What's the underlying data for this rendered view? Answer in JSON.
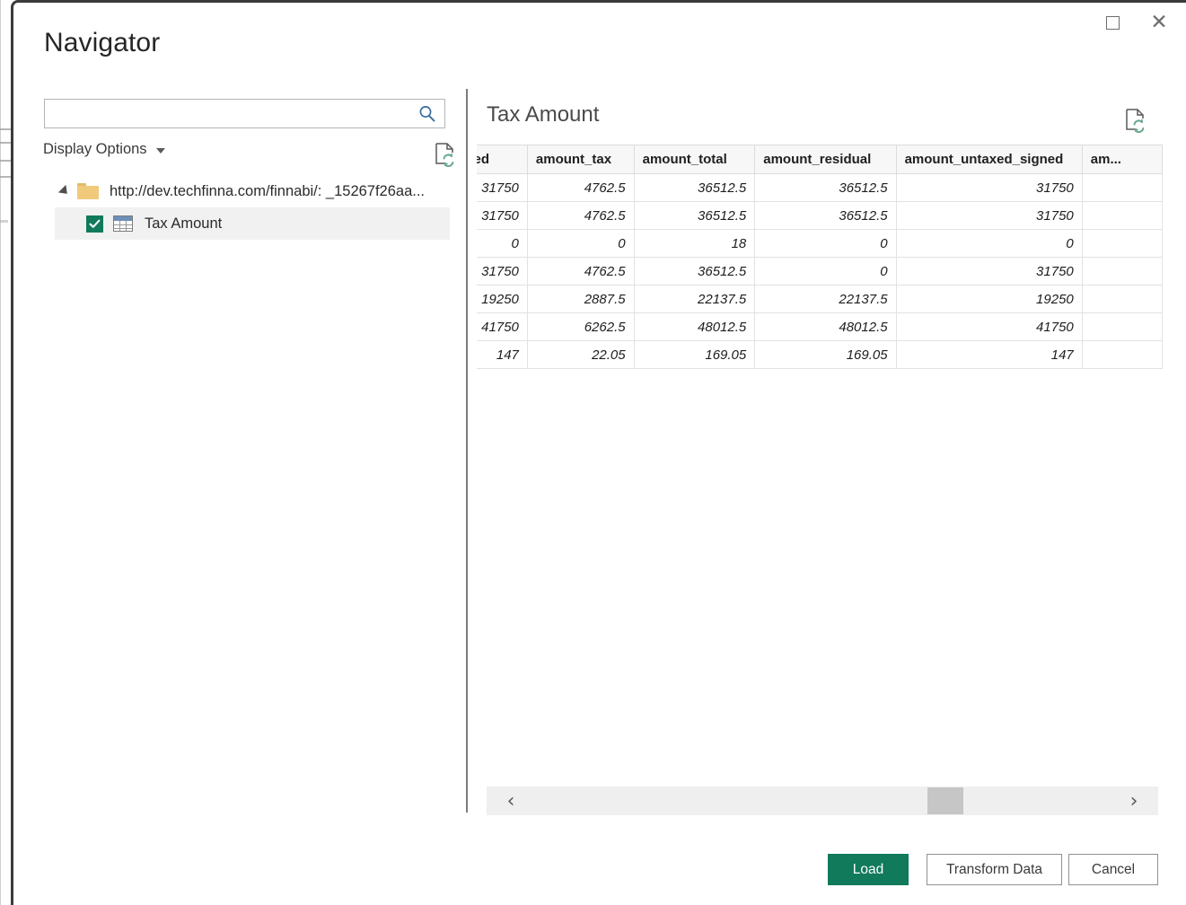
{
  "window": {
    "title": "Navigator",
    "maximize_label": "Maximize",
    "close_label": "Close"
  },
  "search": {
    "value": "",
    "placeholder": "",
    "icon": "search-icon"
  },
  "left_pane": {
    "display_options_label": "Display Options",
    "refresh_icon": "document-refresh-icon",
    "tree": {
      "root": {
        "label": "http://dev.techfinna.com/finnabi/: _15267f26aa...",
        "icon": "folder-icon",
        "expanded": true
      },
      "children": [
        {
          "label": "Tax Amount",
          "icon": "table-icon",
          "checked": true,
          "selected": true
        }
      ]
    }
  },
  "preview": {
    "title": "Tax Amount",
    "refresh_icon": "document-refresh-icon",
    "scrollbar": {
      "left_arrow": "‹",
      "right_arrow": "›"
    }
  },
  "footer": {
    "load_label": "Load",
    "transform_label": "Transform Data",
    "cancel_label": "Cancel"
  },
  "colors": {
    "accent_green": "#107a5b",
    "title_text": "#262626",
    "header_bg": "#f7f7f7",
    "selected_row_bg": "#f1f1f1",
    "folder_yellow": "#f0c97b"
  },
  "chart_data": {
    "type": "table",
    "title": "Tax Amount",
    "columns": [
      "...ed",
      "amount_tax",
      "amount_total",
      "amount_residual",
      "amount_untaxed_signed",
      "am..."
    ],
    "rows": [
      [
        "31750",
        "4762.5",
        "36512.5",
        "36512.5",
        "31750",
        ""
      ],
      [
        "31750",
        "4762.5",
        "36512.5",
        "36512.5",
        "31750",
        ""
      ],
      [
        "0",
        "0",
        "18",
        "0",
        "0",
        ""
      ],
      [
        "31750",
        "4762.5",
        "36512.5",
        "0",
        "31750",
        ""
      ],
      [
        "19250",
        "2887.5",
        "22137.5",
        "22137.5",
        "19250",
        ""
      ],
      [
        "41750",
        "6262.5",
        "48012.5",
        "48012.5",
        "41750",
        ""
      ],
      [
        "147",
        "22.05",
        "169.05",
        "169.05",
        "147",
        ""
      ]
    ]
  }
}
